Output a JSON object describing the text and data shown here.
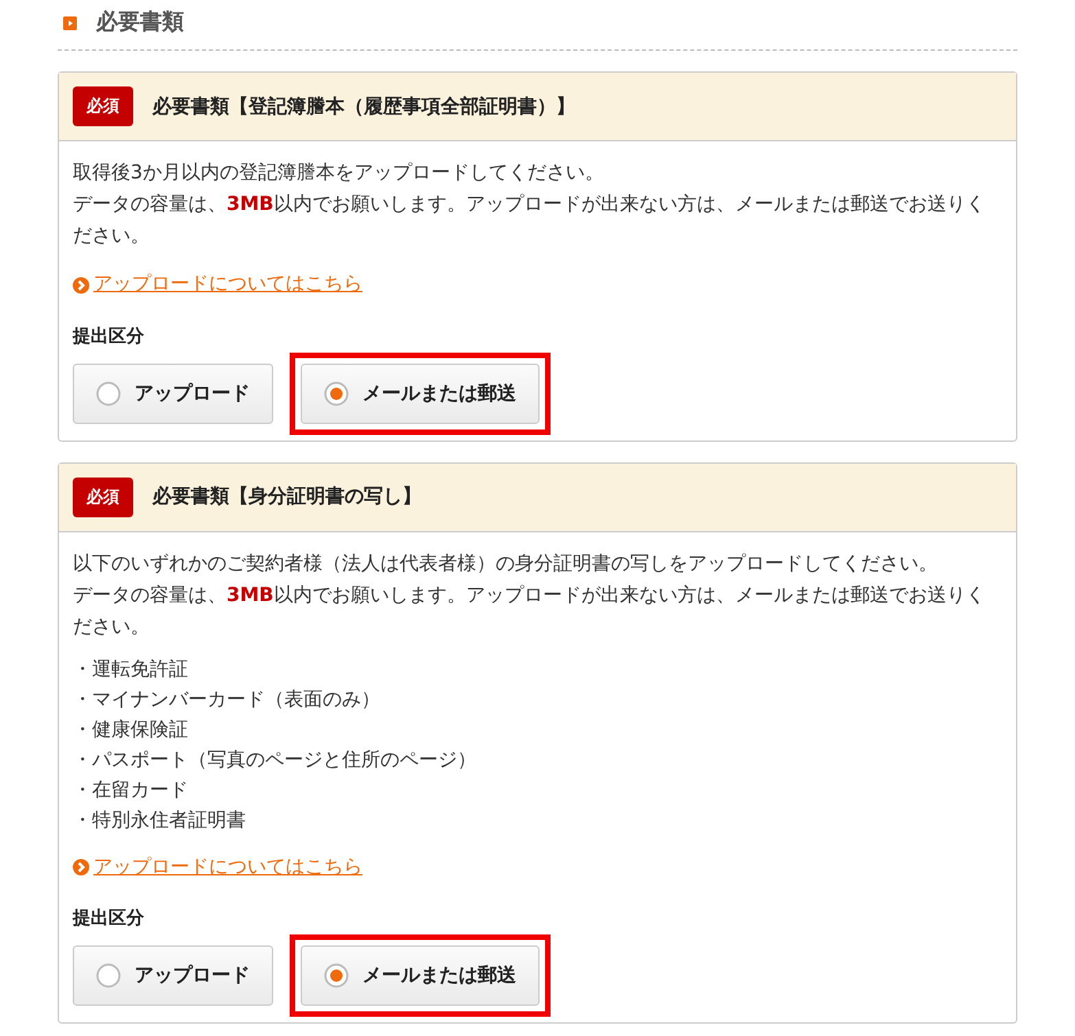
{
  "section": {
    "title": "必要書類"
  },
  "cards": [
    {
      "badge": "必須",
      "title": "必要書類【登記簿謄本（履歴事項全部証明書）】",
      "lines": [
        "取得後3か月以内の登記簿謄本をアップロードしてください。",
        "データの容量は、**3MB**以内でお願いします。アップロードが出来ない方は、メールまたは郵送でお送りください。"
      ],
      "link": "アップロードについてはこちら",
      "field_label": "提出区分",
      "options": [
        {
          "label": "アップロード",
          "selected": false
        },
        {
          "label": "メールまたは郵送",
          "selected": true
        }
      ]
    },
    {
      "badge": "必須",
      "title": "必要書類【身分証明書の写し】",
      "lines": [
        "以下のいずれかのご契約者様（法人は代表者様）の身分証明書の写しをアップロードしてください。",
        "データの容量は、**3MB**以内でお願いします。アップロードが出来ない方は、メールまたは郵送でお送りください。"
      ],
      "list": [
        "・運転免許証",
        "・マイナンバーカード（表面のみ）",
        "・健康保険証",
        "・パスポート（写真のページと住所のページ）",
        "・在留カード",
        "・特別永住者証明書"
      ],
      "link": "アップロードについてはこちら",
      "field_label": "提出区分",
      "options": [
        {
          "label": "アップロード",
          "selected": false
        },
        {
          "label": "メールまたは郵送",
          "selected": true
        }
      ]
    }
  ]
}
